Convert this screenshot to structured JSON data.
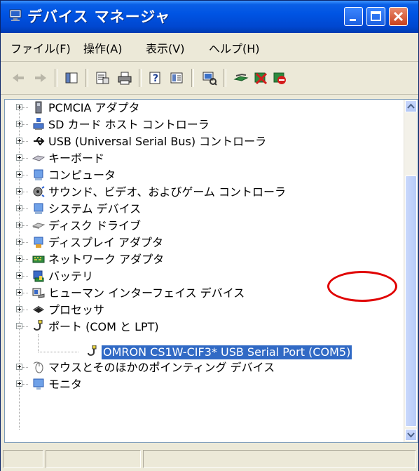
{
  "window": {
    "title": "デバイス マネージャ"
  },
  "menu": [
    {
      "label": "ファイル(F)"
    },
    {
      "label": "操作(A)"
    },
    {
      "label": "表示(V)"
    },
    {
      "label": "ヘルプ(H)"
    }
  ],
  "tree": [
    {
      "label": "PCMCIA アダプタ",
      "icon": "pcmcia-icon",
      "expanded": false
    },
    {
      "label": "SD カード ホスト コントローラ",
      "icon": "sd-host-icon",
      "expanded": false
    },
    {
      "label": "USB (Universal Serial Bus) コントローラ",
      "icon": "usb-icon",
      "expanded": false
    },
    {
      "label": "キーボード",
      "icon": "keyboard-icon",
      "expanded": false
    },
    {
      "label": "コンピュータ",
      "icon": "computer-icon",
      "expanded": false
    },
    {
      "label": "サウンド、ビデオ、およびゲーム コントローラ",
      "icon": "sound-icon",
      "expanded": false
    },
    {
      "label": "システム デバイス",
      "icon": "system-device-icon",
      "expanded": false
    },
    {
      "label": "ディスク ドライブ",
      "icon": "disk-drive-icon",
      "expanded": false
    },
    {
      "label": "ディスプレイ アダプタ",
      "icon": "display-adapter-icon",
      "expanded": false
    },
    {
      "label": "ネットワーク アダプタ",
      "icon": "network-adapter-icon",
      "expanded": false
    },
    {
      "label": "バッテリ",
      "icon": "battery-icon",
      "expanded": false
    },
    {
      "label": "ヒューマン インターフェイス デバイス",
      "icon": "hid-icon",
      "expanded": false
    },
    {
      "label": "プロセッサ",
      "icon": "processor-icon",
      "expanded": false
    },
    {
      "label": "ポート (COM と LPT)",
      "icon": "port-icon",
      "expanded": true
    },
    {
      "label": "OMRON CS1W-CIF3* USB Serial Port (COM5)",
      "icon": "port-icon",
      "child": true,
      "selected": true
    },
    {
      "label": "マウスとそのほかのポインティング デバイス",
      "icon": "mouse-icon",
      "expanded": false
    },
    {
      "label": "モニタ",
      "icon": "monitor-icon",
      "expanded": false
    }
  ],
  "colors": {
    "titlebar": "#0054e3",
    "selection": "#316ac5",
    "highlight_ring": "#e00000"
  }
}
